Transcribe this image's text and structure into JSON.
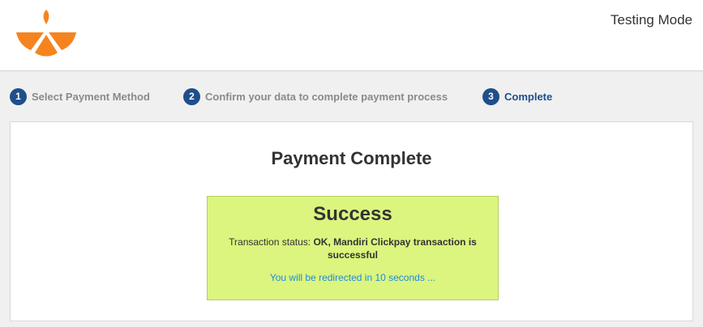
{
  "header": {
    "logo_icon": "orange-slice-logo-icon",
    "mode_label": "Testing Mode"
  },
  "steps": [
    {
      "number": "1",
      "label": "Select Payment Method",
      "active": false
    },
    {
      "number": "2",
      "label": "Confirm your data to complete payment process",
      "active": false
    },
    {
      "number": "3",
      "label": "Complete",
      "active": true
    }
  ],
  "panel": {
    "title": "Payment Complete",
    "result": {
      "title": "Success",
      "status_prefix": "Transaction status:",
      "status_value": "OK, Mandiri Clickpay transaction is successful",
      "redirect_text": "You will be redirected in 10 seconds ..."
    }
  },
  "colors": {
    "step_active": "#1f4f8a",
    "step_inactive": "#8a8a8a",
    "success_bg": "#dbf57e",
    "redirect_link": "#1e8ae0",
    "logo_orange": "#f5841f"
  }
}
